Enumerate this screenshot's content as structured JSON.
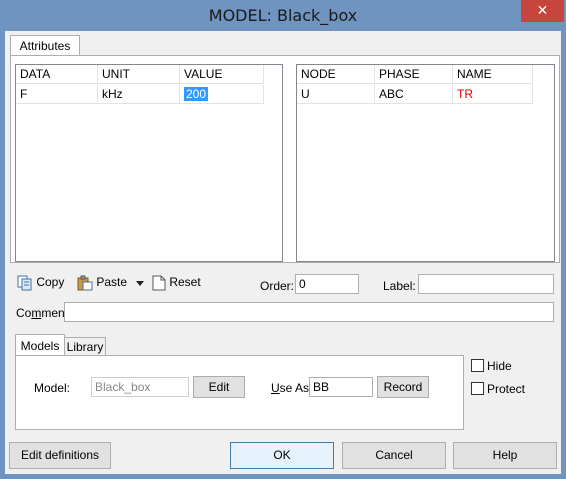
{
  "window": {
    "title": "MODEL: Black_box",
    "close_glyph": "✕"
  },
  "tabs": {
    "attributes": "Attributes"
  },
  "data_table": {
    "headers": [
      "DATA",
      "UNIT",
      "VALUE"
    ],
    "rows": [
      {
        "data": "F",
        "unit": "kHz",
        "value": "200"
      }
    ]
  },
  "node_table": {
    "headers": [
      "NODE",
      "PHASE",
      "NAME"
    ],
    "rows": [
      {
        "node": "U",
        "phase": "ABC",
        "name": "TR"
      }
    ]
  },
  "toolbar": {
    "copy": "Copy",
    "paste": "Paste",
    "reset": "Reset",
    "order_label": "Order:",
    "order_value": "0",
    "label_label": "Label:",
    "label_value": ""
  },
  "comment": {
    "label_pre": "Co",
    "label_ul": "m",
    "label_post": "ment:",
    "value": ""
  },
  "subtabs": {
    "models": "Models",
    "library": "Library"
  },
  "model_section": {
    "model_label": "Model:",
    "model_value": "Black_box",
    "edit": "Edit",
    "use_as_ul": "U",
    "use_as_rest": "se As:",
    "use_as_value": "BB",
    "record": "Record"
  },
  "options": {
    "hide": "Hide",
    "protect": "Protect"
  },
  "footer": {
    "edit_definitions": "Edit definitions",
    "ok": "OK",
    "cancel": "Cancel",
    "help": "Help"
  },
  "colors": {
    "titlebar": "#6f94bf",
    "close": "#c7453c",
    "selection": "#3399ff",
    "name_red": "#e00000"
  }
}
